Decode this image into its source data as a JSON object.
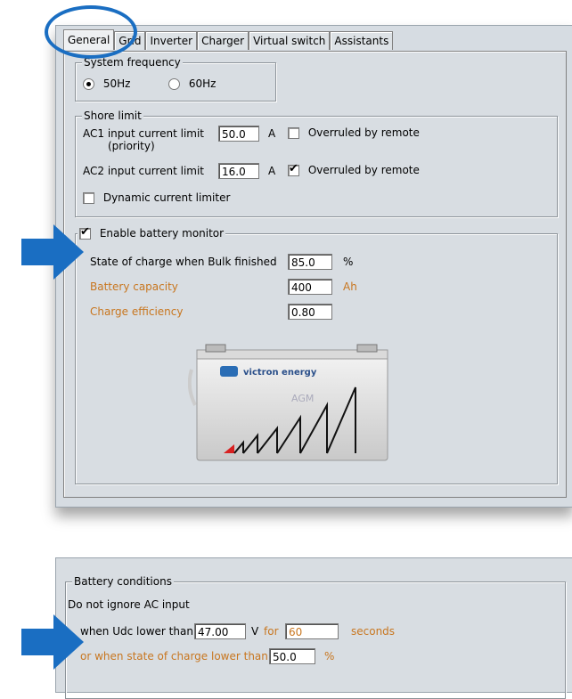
{
  "tabs": [
    "General",
    "Grid",
    "Inverter",
    "Charger",
    "Virtual switch",
    "Assistants"
  ],
  "system_frequency": {
    "legend": "System frequency",
    "option_50": "50Hz",
    "option_60": "60Hz",
    "selected": "50Hz"
  },
  "shore_limit": {
    "legend": "Shore limit",
    "ac1_label": "AC1 input current limit",
    "ac1_sub": "(priority)",
    "ac1_value": "50.0",
    "ac1_unit": "A",
    "ac1_overruled_label": "Overruled by remote",
    "ac1_overruled": false,
    "ac2_label": "AC2 input current limit",
    "ac2_value": "16.0",
    "ac2_unit": "A",
    "ac2_overruled_label": "Overruled by remote",
    "ac2_overruled": true,
    "dynamic_label": "Dynamic current limiter",
    "dynamic_checked": false
  },
  "battery_monitor": {
    "enable_label": "Enable battery monitor",
    "enabled": true,
    "soc_label": "State of charge when Bulk finished",
    "soc_value": "85.0",
    "soc_unit": "%",
    "capacity_label": "Battery capacity",
    "capacity_value": "400",
    "capacity_unit": "Ah",
    "efficiency_label": "Charge efficiency",
    "efficiency_value": "0.80",
    "battery_brand": "victron energy",
    "battery_type": "AGM"
  },
  "battery_conditions": {
    "legend": "Battery conditions",
    "line1": "Do not ignore AC input",
    "udc_label": "when Udc lower than:",
    "udc_value": "47.00",
    "udc_unit": "V",
    "for_label": "for",
    "seconds_value": "60",
    "seconds_label": "seconds",
    "soc_label": "or when state of charge lower than:",
    "soc_value": "50.0",
    "soc_unit": "%"
  },
  "colors": {
    "highlight": "#1a6ec2",
    "orange_text": "#c8761f",
    "panel_bg": "#d8dde2"
  }
}
